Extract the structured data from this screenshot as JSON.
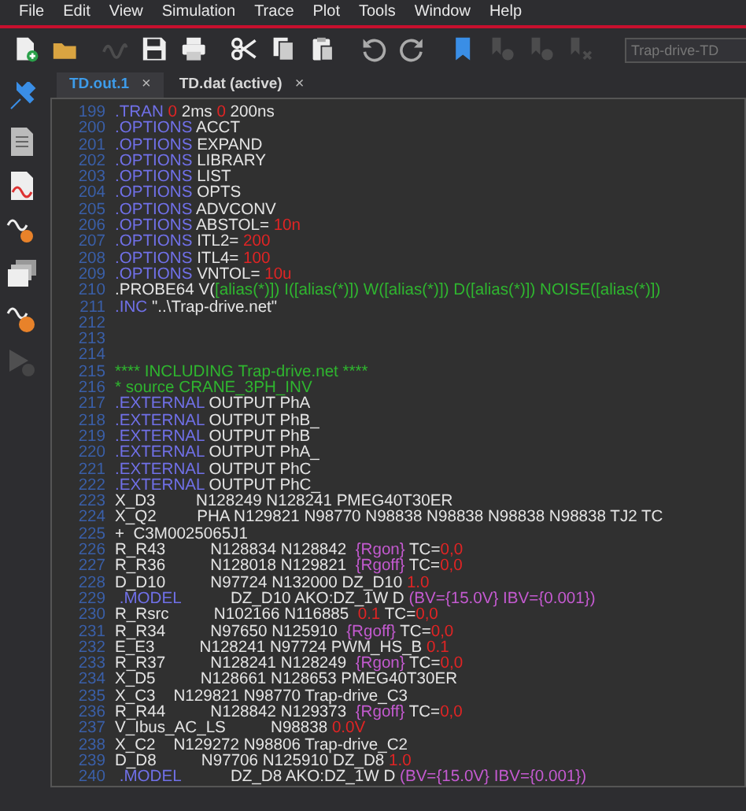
{
  "menu": [
    "File",
    "Edit",
    "View",
    "Simulation",
    "Trace",
    "Plot",
    "Tools",
    "Window",
    "Help"
  ],
  "toolbar": [
    {
      "kind": "new",
      "disabled": false
    },
    {
      "kind": "open",
      "disabled": false
    },
    {
      "kind": "wave",
      "disabled": true
    },
    {
      "kind": "save",
      "disabled": false
    },
    {
      "kind": "print",
      "disabled": false
    },
    {
      "kind": "cut",
      "disabled": false
    },
    {
      "kind": "copy",
      "disabled": false
    },
    {
      "kind": "paste",
      "disabled": false
    },
    {
      "kind": "undo",
      "disabled": false
    },
    {
      "kind": "redo",
      "disabled": false
    },
    {
      "kind": "bookmark",
      "disabled": false
    },
    {
      "kind": "bookmark-next",
      "disabled": true
    },
    {
      "kind": "bookmark-prev",
      "disabled": true
    },
    {
      "kind": "bookmark-clear",
      "disabled": true
    }
  ],
  "profile_field": {
    "value": "Trap-drive-TD"
  },
  "sidebar": [
    {
      "kind": "pin",
      "disabled": false
    },
    {
      "kind": "document",
      "disabled": false
    },
    {
      "kind": "wave-document",
      "disabled": false
    },
    {
      "kind": "wave-search",
      "disabled": false
    },
    {
      "kind": "windows",
      "disabled": false
    },
    {
      "kind": "wave-edit",
      "disabled": false
    },
    {
      "kind": "run",
      "disabled": true
    }
  ],
  "tabs": [
    {
      "label": "TD.out.1",
      "selected": true,
      "close": "×"
    },
    {
      "label": "TD.dat (active)",
      "selected": false,
      "close": "×"
    }
  ],
  "lines": [
    {
      "number": "199",
      "segments": [
        {
          "kind": "keyword",
          "text": ".TRAN"
        },
        {
          "kind": "number",
          "text": " 0"
        },
        {
          "kind": "plain",
          "text": " 2ms"
        },
        {
          "kind": "number",
          "text": " 0"
        },
        {
          "kind": "plain",
          "text": " 200ns"
        }
      ]
    },
    {
      "number": "200",
      "segments": [
        {
          "kind": "keyword",
          "text": ".OPTIONS"
        },
        {
          "kind": "plain",
          "text": " ACCT"
        }
      ]
    },
    {
      "number": "201",
      "segments": [
        {
          "kind": "keyword",
          "text": ".OPTIONS"
        },
        {
          "kind": "plain",
          "text": " EXPAND"
        }
      ]
    },
    {
      "number": "202",
      "segments": [
        {
          "kind": "keyword",
          "text": ".OPTIONS"
        },
        {
          "kind": "plain",
          "text": " LIBRARY"
        }
      ]
    },
    {
      "number": "203",
      "segments": [
        {
          "kind": "keyword",
          "text": ".OPTIONS"
        },
        {
          "kind": "plain",
          "text": " LIST"
        }
      ]
    },
    {
      "number": "204",
      "segments": [
        {
          "kind": "keyword",
          "text": ".OPTIONS"
        },
        {
          "kind": "plain",
          "text": " OPTS"
        }
      ]
    },
    {
      "number": "205",
      "segments": [
        {
          "kind": "keyword",
          "text": ".OPTIONS"
        },
        {
          "kind": "plain",
          "text": " ADVCONV"
        }
      ]
    },
    {
      "number": "206",
      "segments": [
        {
          "kind": "keyword",
          "text": ".OPTIONS"
        },
        {
          "kind": "plain",
          "text": " ABSTOL="
        },
        {
          "kind": "number",
          "text": " 10n"
        }
      ]
    },
    {
      "number": "207",
      "segments": [
        {
          "kind": "keyword",
          "text": ".OPTIONS"
        },
        {
          "kind": "plain",
          "text": " ITL2="
        },
        {
          "kind": "number",
          "text": " 200"
        }
      ]
    },
    {
      "number": "208",
      "segments": [
        {
          "kind": "keyword",
          "text": ".OPTIONS"
        },
        {
          "kind": "plain",
          "text": " ITL4="
        },
        {
          "kind": "number",
          "text": " 100"
        }
      ]
    },
    {
      "number": "209",
      "segments": [
        {
          "kind": "keyword",
          "text": ".OPTIONS"
        },
        {
          "kind": "plain",
          "text": " VNTOL="
        },
        {
          "kind": "number",
          "text": " 10u"
        }
      ]
    },
    {
      "number": "210",
      "segments": [
        {
          "kind": "plain",
          "text": ".PROBE64 V("
        },
        {
          "kind": "comment",
          "text": "[alias(*)]) I([alias(*)]) W([alias(*)]) D([alias(*)]) NOISE([alias(*)])"
        }
      ]
    },
    {
      "number": "211",
      "segments": [
        {
          "kind": "keyword",
          "text": ".INC"
        },
        {
          "kind": "plain",
          "text": " \"..\\Trap-drive.net\""
        }
      ]
    },
    {
      "number": "212"
    },
    {
      "number": "213"
    },
    {
      "number": "214"
    },
    {
      "number": "215",
      "segments": [
        {
          "kind": "comment",
          "text": "**** INCLUDING Trap-drive.net ****"
        }
      ]
    },
    {
      "number": "216",
      "segments": [
        {
          "kind": "comment",
          "text": "* source CRANE_3PH_INV"
        }
      ]
    },
    {
      "number": "217",
      "segments": [
        {
          "kind": "keyword",
          "text": ".EXTERNAL"
        },
        {
          "kind": "plain",
          "text": " OUTPUT PhA"
        }
      ]
    },
    {
      "number": "218",
      "segments": [
        {
          "kind": "keyword",
          "text": ".EXTERNAL"
        },
        {
          "kind": "plain",
          "text": " OUTPUT PhB_"
        }
      ]
    },
    {
      "number": "219",
      "segments": [
        {
          "kind": "keyword",
          "text": ".EXTERNAL"
        },
        {
          "kind": "plain",
          "text": " OUTPUT PhB"
        }
      ]
    },
    {
      "number": "220",
      "segments": [
        {
          "kind": "keyword",
          "text": ".EXTERNAL"
        },
        {
          "kind": "plain",
          "text": " OUTPUT PhA_"
        }
      ]
    },
    {
      "number": "221",
      "segments": [
        {
          "kind": "keyword",
          "text": ".EXTERNAL"
        },
        {
          "kind": "plain",
          "text": " OUTPUT PhC"
        }
      ]
    },
    {
      "number": "222",
      "segments": [
        {
          "kind": "keyword",
          "text": ".EXTERNAL"
        },
        {
          "kind": "plain",
          "text": " OUTPUT PhC_"
        }
      ]
    },
    {
      "number": "223",
      "segments": [
        {
          "kind": "plain",
          "text": "X_D3         N128249 N128241 PMEG40T30ER"
        }
      ]
    },
    {
      "number": "224",
      "segments": [
        {
          "kind": "plain",
          "text": "X_Q2         PHA N129821 N98770 N98838 N98838 N98838 N98838 TJ2 TC"
        }
      ]
    },
    {
      "number": "225",
      "segments": [
        {
          "kind": "plain",
          "text": "+  C3M0025065J1"
        }
      ]
    },
    {
      "number": "226",
      "segments": [
        {
          "kind": "plain",
          "text": "R_R43          N128834 N128842 "
        },
        {
          "kind": "param",
          "text": " {Rgon}"
        },
        {
          "kind": "plain",
          "text": " TC="
        },
        {
          "kind": "number",
          "text": "0,0"
        }
      ]
    },
    {
      "number": "227",
      "segments": [
        {
          "kind": "plain",
          "text": "R_R36          N128018 N129821 "
        },
        {
          "kind": "param",
          "text": " {Rgoff}"
        },
        {
          "kind": "plain",
          "text": " TC="
        },
        {
          "kind": "number",
          "text": "0,0"
        }
      ]
    },
    {
      "number": "228",
      "segments": [
        {
          "kind": "plain",
          "text": "D_D10          N97724 N132000 DZ_D10"
        },
        {
          "kind": "number",
          "text": " 1.0"
        }
      ]
    },
    {
      "number": "229",
      "segments": [
        {
          "kind": "keyword",
          "text": " .MODEL"
        },
        {
          "kind": "plain",
          "text": "           DZ_D10 AKO:DZ_1W D "
        },
        {
          "kind": "param",
          "text": "(BV={15.0V} IBV={0.001})"
        }
      ]
    },
    {
      "number": "230",
      "segments": [
        {
          "kind": "plain",
          "text": "R_Rsrc          N102166 N116885"
        },
        {
          "kind": "number",
          "text": "  0.1"
        },
        {
          "kind": "plain",
          "text": " TC="
        },
        {
          "kind": "number",
          "text": "0,0"
        }
      ]
    },
    {
      "number": "231",
      "segments": [
        {
          "kind": "plain",
          "text": "R_R34          N97650 N125910 "
        },
        {
          "kind": "param",
          "text": " {Rgoff}"
        },
        {
          "kind": "plain",
          "text": " TC="
        },
        {
          "kind": "number",
          "text": "0,0"
        }
      ]
    },
    {
      "number": "232",
      "segments": [
        {
          "kind": "plain",
          "text": "E_E3          N128241 N97724 PWM_HS_B"
        },
        {
          "kind": "number",
          "text": " 0.1"
        }
      ]
    },
    {
      "number": "233",
      "segments": [
        {
          "kind": "plain",
          "text": "R_R37          N128241 N128249 "
        },
        {
          "kind": "param",
          "text": " {Rgon}"
        },
        {
          "kind": "plain",
          "text": " TC="
        },
        {
          "kind": "number",
          "text": "0,0"
        }
      ]
    },
    {
      "number": "234",
      "segments": [
        {
          "kind": "plain",
          "text": "X_D5          N128661 N128653 PMEG40T30ER"
        }
      ]
    },
    {
      "number": "235",
      "segments": [
        {
          "kind": "plain",
          "text": "X_C3    N129821 N98770 Trap-drive_C3"
        }
      ]
    },
    {
      "number": "236",
      "segments": [
        {
          "kind": "plain",
          "text": "R_R44          N128842 N129373 "
        },
        {
          "kind": "param",
          "text": " {Rgoff}"
        },
        {
          "kind": "plain",
          "text": " TC="
        },
        {
          "kind": "number",
          "text": "0,0"
        }
      ]
    },
    {
      "number": "237",
      "segments": [
        {
          "kind": "plain",
          "text": "V_Ibus_AC_LS          N98838"
        },
        {
          "kind": "number",
          "text": " 0.0V"
        }
      ]
    },
    {
      "number": "238",
      "segments": [
        {
          "kind": "plain",
          "text": "X_C2    N129272 N98806 Trap-drive_C2"
        }
      ]
    },
    {
      "number": "239",
      "segments": [
        {
          "kind": "plain",
          "text": "D_D8          N97706 N125910 DZ_D8"
        },
        {
          "kind": "number",
          "text": " 1.0"
        }
      ]
    },
    {
      "number": "240",
      "segments": [
        {
          "kind": "keyword",
          "text": " .MODEL"
        },
        {
          "kind": "plain",
          "text": "           DZ_D8 AKO:DZ_1W D "
        },
        {
          "kind": "param",
          "text": "(BV={15.0V} IBV={0.001})"
        }
      ]
    }
  ]
}
